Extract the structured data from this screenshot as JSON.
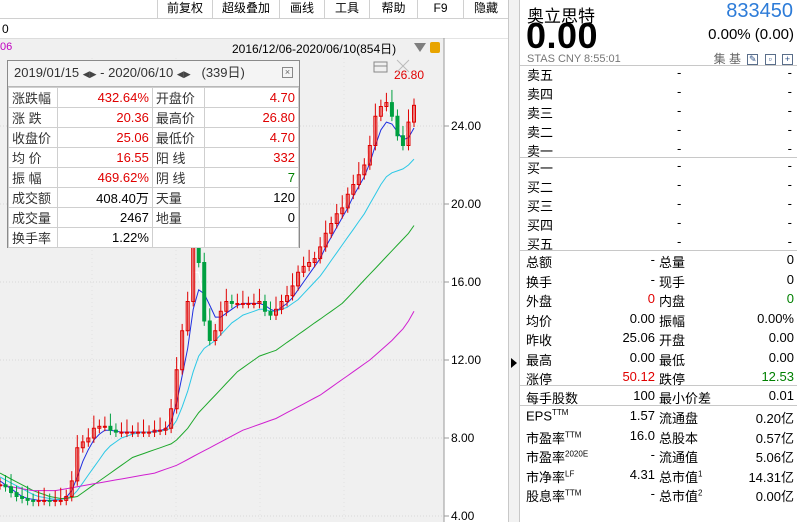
{
  "toolbar": {
    "items": [
      "前复权",
      "超级叠加",
      "画线",
      "工具",
      "帮助",
      "F9",
      "隐藏"
    ],
    "left_digit": "0"
  },
  "chart": {
    "range_label": "2016/12/06-2020/06/10(854日)",
    "left_mark": "06",
    "peak_label": "26.80",
    "y_ticks": [
      "24.00",
      "20.00",
      "16.00",
      "12.00",
      "8.00",
      "4.00"
    ]
  },
  "chart_data": {
    "type": "candlestick",
    "y_axis_ticks": [
      24,
      20,
      16,
      12,
      8,
      4
    ],
    "series": [
      {
        "name": "close",
        "values": [
          5.6,
          5.5,
          5.2,
          5.0,
          4.9,
          4.8,
          4.75,
          4.8,
          4.8,
          4.75,
          4.8,
          4.8,
          5.0,
          5.8,
          7.5,
          7.8,
          8.0,
          8.5,
          8.6,
          8.6,
          8.4,
          8.3,
          8.3,
          8.3,
          8.3,
          8.3,
          8.3,
          8.3,
          8.4,
          8.4,
          8.5,
          9.5,
          11.5,
          13.5,
          15.0,
          19.0,
          17.0,
          14.0,
          13.0,
          13.5,
          14.5,
          15.0,
          14.9,
          14.9,
          14.9,
          14.9,
          14.9,
          15.0,
          14.5,
          14.3,
          14.6,
          15.0,
          15.3,
          15.8,
          16.5,
          16.8,
          17.0,
          17.2,
          17.8,
          18.5,
          19.0,
          19.5,
          19.8,
          20.5,
          21.0,
          21.5,
          22.0,
          23.0,
          24.5,
          25.0,
          25.2,
          24.5,
          23.5,
          23.0,
          24.2,
          25.06
        ]
      },
      {
        "name": "ma-white",
        "values": [
          5.5,
          5.3,
          5.1,
          5.0,
          4.9,
          4.85,
          4.8,
          4.8,
          4.8,
          4.8,
          4.8,
          4.9,
          5.2,
          6.0,
          6.8,
          7.6,
          8.0,
          8.3,
          8.5,
          8.5,
          8.4,
          8.3,
          8.3,
          8.3,
          8.3,
          8.3,
          8.3,
          8.3,
          8.4,
          8.4,
          8.6,
          9.4,
          11.0,
          12.8,
          14.5,
          16.5,
          16.5,
          15.0,
          14.0,
          14.0,
          14.3,
          14.8,
          14.9,
          14.9,
          14.9,
          14.9,
          14.9,
          14.9,
          14.7,
          14.5,
          14.6,
          14.9,
          15.2,
          15.6,
          16.2,
          16.6,
          16.9,
          17.2,
          17.7,
          18.3,
          18.9,
          19.4,
          19.8,
          20.4,
          21.0,
          21.5,
          22.0,
          22.9,
          24.0,
          24.6,
          24.8,
          24.4,
          23.8,
          23.4,
          23.9,
          24.6
        ]
      },
      {
        "name": "ma-blue",
        "values": [
          5.8,
          5.6,
          5.4,
          5.2,
          5.0,
          4.9,
          4.85,
          4.8,
          4.8,
          4.8,
          4.8,
          4.85,
          4.95,
          5.3,
          6.0,
          6.8,
          7.4,
          7.9,
          8.2,
          8.4,
          8.4,
          8.35,
          8.3,
          8.3,
          8.3,
          8.3,
          8.3,
          8.3,
          8.35,
          8.4,
          8.45,
          8.8,
          9.8,
          11.2,
          12.6,
          14.6,
          15.6,
          15.4,
          14.8,
          14.2,
          14.2,
          14.4,
          14.6,
          14.8,
          14.9,
          14.9,
          14.9,
          14.9,
          14.8,
          14.6,
          14.5,
          14.7,
          14.9,
          15.2,
          15.6,
          16.0,
          16.4,
          16.8,
          17.2,
          17.8,
          18.3,
          18.8,
          19.3,
          19.8,
          20.4,
          20.9,
          21.4,
          22.1,
          23.0,
          23.8,
          24.2,
          24.1,
          23.7,
          23.3,
          23.4,
          23.9
        ]
      },
      {
        "name": "ma-cyan",
        "values": [
          6.0,
          5.85,
          5.7,
          5.55,
          5.4,
          5.25,
          5.1,
          5.0,
          4.95,
          4.9,
          4.85,
          4.85,
          4.9,
          5.0,
          5.3,
          5.7,
          6.1,
          6.5,
          6.9,
          7.3,
          7.6,
          7.8,
          8.0,
          8.1,
          8.2,
          8.25,
          8.3,
          8.3,
          8.3,
          8.35,
          8.4,
          8.5,
          8.9,
          9.6,
          10.4,
          11.4,
          12.2,
          12.6,
          12.8,
          13.0,
          13.3,
          13.6,
          13.9,
          14.1,
          14.3,
          14.4,
          14.5,
          14.6,
          14.6,
          14.5,
          14.5,
          14.6,
          14.7,
          14.9,
          15.1,
          15.4,
          15.7,
          16.0,
          16.3,
          16.7,
          17.1,
          17.5,
          17.9,
          18.3,
          18.7,
          19.1,
          19.5,
          20.0,
          20.5,
          21.0,
          21.4,
          21.6,
          21.7,
          21.8,
          22.0,
          22.3
        ]
      },
      {
        "name": "ma-green",
        "values": [
          6.2,
          6.05,
          5.9,
          5.75,
          5.6,
          5.45,
          5.3,
          5.2,
          5.1,
          5.0,
          4.95,
          4.9,
          4.9,
          4.95,
          5.0,
          5.2,
          5.4,
          5.6,
          5.8,
          6.0,
          6.2,
          6.4,
          6.6,
          6.8,
          7.0,
          7.1,
          7.2,
          7.3,
          7.4,
          7.5,
          7.6,
          7.7,
          7.9,
          8.2,
          8.5,
          8.9,
          9.3,
          9.6,
          9.9,
          10.2,
          10.5,
          10.8,
          11.1,
          11.4,
          11.6,
          11.8,
          12.0,
          12.2,
          12.3,
          12.4,
          12.5,
          12.7,
          12.9,
          13.1,
          13.3,
          13.5,
          13.7,
          13.9,
          14.1,
          14.3,
          14.5,
          14.7,
          14.9,
          15.2,
          15.5,
          15.8,
          16.1,
          16.4,
          16.7,
          17.0,
          17.3,
          17.6,
          17.9,
          18.2,
          18.5,
          18.9
        ]
      },
      {
        "name": "ma-magenta",
        "values": [
          5.6,
          5.55,
          5.5,
          5.45,
          5.4,
          5.35,
          5.3,
          5.3,
          5.3,
          5.3,
          5.3,
          5.35,
          5.4,
          5.45,
          5.5,
          5.55,
          5.6,
          5.65,
          5.7,
          5.75,
          5.8,
          5.85,
          5.9,
          5.95,
          6.0,
          6.05,
          6.1,
          6.15,
          6.2,
          6.3,
          6.4,
          6.5,
          6.6,
          6.75,
          6.9,
          7.05,
          7.2,
          7.35,
          7.5,
          7.65,
          7.8,
          7.95,
          8.1,
          8.25,
          8.4,
          8.5,
          8.6,
          8.7,
          8.8,
          8.9,
          9.0,
          9.15,
          9.3,
          9.45,
          9.6,
          9.75,
          9.9,
          10.05,
          10.2,
          10.4,
          10.6,
          10.8,
          11.0,
          11.2,
          11.4,
          11.6,
          11.8,
          12.0,
          12.25,
          12.5,
          12.75,
          13.0,
          13.3,
          13.6,
          14.0,
          14.5
        ]
      }
    ]
  },
  "popup": {
    "date_from": "2019/01/15",
    "date_to": "2020/06/10",
    "days": "(339日)",
    "rows": [
      {
        "k1": "涨跌幅",
        "v1": "432.64%",
        "c1": "red",
        "k2": "开盘价",
        "v2": "4.70",
        "c2": "red"
      },
      {
        "k1": "涨  跌",
        "v1": "20.36",
        "c1": "red",
        "k2": "最高价",
        "v2": "26.80",
        "c2": "red"
      },
      {
        "k1": "收盘价",
        "v1": "25.06",
        "c1": "red",
        "k2": "最低价",
        "v2": "4.70",
        "c2": "red"
      },
      {
        "k1": "均  价",
        "v1": "16.55",
        "c1": "red",
        "k2": "阳  线",
        "v2": "332",
        "c2": "red"
      },
      {
        "k1": "振  幅",
        "v1": "469.62%",
        "c1": "red",
        "k2": "阴  线",
        "v2": "7",
        "c2": "green"
      },
      {
        "k1": "成交额",
        "v1": "408.40万",
        "c1": "blk",
        "k2": "天量",
        "v2": "120",
        "c2": "blk"
      },
      {
        "k1": "成交量",
        "v1": "2467",
        "c1": "blk",
        "k2": "地量",
        "v2": "0",
        "c2": "blk"
      },
      {
        "k1": "换手率",
        "v1": "1.22%",
        "c1": "blk",
        "k2": "",
        "v2": "",
        "c2": "blk"
      }
    ]
  },
  "quote": {
    "name": "奥立思特",
    "code": "833450",
    "price": "0.00",
    "change": "0.00% (0.00)",
    "sub": "STAS  CNY  8:55:01",
    "sub_icons": [
      "集",
      "基"
    ]
  },
  "orderbook": {
    "asks": [
      {
        "k": "卖五",
        "a": "-",
        "b": "-"
      },
      {
        "k": "卖四",
        "a": "-",
        "b": "-"
      },
      {
        "k": "卖三",
        "a": "-",
        "b": "-"
      },
      {
        "k": "卖二",
        "a": "-",
        "b": "-"
      },
      {
        "k": "卖一",
        "a": "-",
        "b": "-"
      }
    ],
    "bids": [
      {
        "k": "买一",
        "a": "-",
        "b": "-"
      },
      {
        "k": "买二",
        "a": "-",
        "b": "-"
      },
      {
        "k": "买三",
        "a": "-",
        "b": "-"
      },
      {
        "k": "买四",
        "a": "-",
        "b": "-"
      },
      {
        "k": "买五",
        "a": "-",
        "b": "-"
      }
    ]
  },
  "stats1": [
    {
      "k1": "总额",
      "v1": "-",
      "c1": "blk",
      "k2": "总量",
      "v2": "0",
      "c2": "blk"
    },
    {
      "k1": "换手",
      "v1": "-",
      "c1": "blk",
      "k2": "现手",
      "v2": "0",
      "c2": "blk"
    },
    {
      "k1": "外盘",
      "v1": "0",
      "c1": "red",
      "k2": "内盘",
      "v2": "0",
      "c2": "green"
    },
    {
      "k1": "均价",
      "v1": "0.00",
      "c1": "blk",
      "k2": "振幅",
      "v2": "0.00%",
      "c2": "blk"
    },
    {
      "k1": "昨收",
      "v1": "25.06",
      "c1": "blk",
      "k2": "开盘",
      "v2": "0.00",
      "c2": "blk"
    },
    {
      "k1": "最高",
      "v1": "0.00",
      "c1": "blk",
      "k2": "最低",
      "v2": "0.00",
      "c2": "blk"
    },
    {
      "k1": "涨停",
      "v1": "50.12",
      "c1": "red",
      "k2": "跌停",
      "v2": "12.53",
      "c2": "green"
    }
  ],
  "stats2": [
    {
      "k1": "每手股数",
      "v1": "100",
      "k2": "最小价差",
      "v2": "0.01"
    }
  ],
  "stats3": [
    {
      "k1": "EPS",
      "s1": "TTM",
      "v1": "1.57",
      "k2": "流通盘",
      "s2": "",
      "v2": "0.20亿"
    },
    {
      "k1": "市盈率",
      "s1": "TTM",
      "v1": "16.0",
      "k2": "总股本",
      "s2": "",
      "v2": "0.57亿"
    },
    {
      "k1": "市盈率",
      "s1": "2020E",
      "v1": "-",
      "k2": "流通值",
      "s2": "",
      "v2": "5.06亿"
    },
    {
      "k1": "市净率",
      "s1": "LF",
      "v1": "4.31",
      "k2": "总市值",
      "s2": "1",
      "v2": "14.31亿"
    },
    {
      "k1": "股息率",
      "s1": "TTM",
      "v1": "-",
      "k2": "总市值",
      "s2": "2",
      "v2": "0.00亿"
    }
  ]
}
